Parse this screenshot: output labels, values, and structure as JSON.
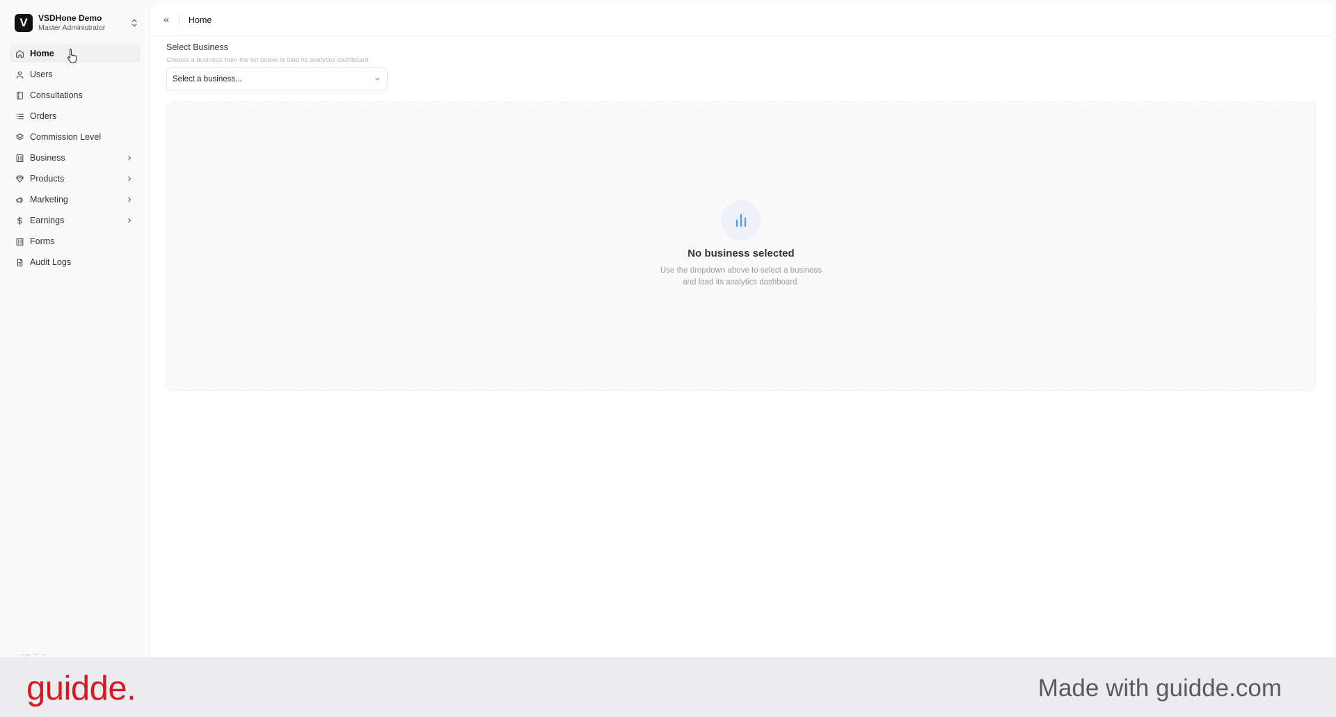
{
  "org": {
    "initial": "V",
    "name": "VSDHone Demo",
    "role": "Master Administrator"
  },
  "sidebar": {
    "items": [
      {
        "label": "Home",
        "icon": "home-icon",
        "active": true,
        "has_children": false
      },
      {
        "label": "Users",
        "icon": "user-icon",
        "active": false,
        "has_children": false
      },
      {
        "label": "Consultations",
        "icon": "book-icon",
        "active": false,
        "has_children": false
      },
      {
        "label": "Orders",
        "icon": "list-icon",
        "active": false,
        "has_children": false
      },
      {
        "label": "Commission Level",
        "icon": "layers-icon",
        "active": false,
        "has_children": false
      },
      {
        "label": "Business",
        "icon": "building-icon",
        "active": false,
        "has_children": true
      },
      {
        "label": "Products",
        "icon": "gem-icon",
        "active": false,
        "has_children": true
      },
      {
        "label": "Marketing",
        "icon": "megaphone-icon",
        "active": false,
        "has_children": true
      },
      {
        "label": "Earnings",
        "icon": "dollar-icon",
        "active": false,
        "has_children": true
      },
      {
        "label": "Forms",
        "icon": "building-icon",
        "active": false,
        "has_children": false
      },
      {
        "label": "Audit Logs",
        "icon": "file-icon",
        "active": false,
        "has_children": false
      }
    ]
  },
  "header": {
    "breadcrumb": "Home"
  },
  "main": {
    "select_title": "Select Business",
    "select_description": "Choose a business from the list below to load its analytics dashboard",
    "select_placeholder": "Select a business...",
    "empty_title": "No business selected",
    "empty_desc_line1": "Use the dropdown above to select a business",
    "empty_desc_line2": "and load its analytics dashboard."
  },
  "footer": {
    "brand": "guidde.",
    "tagline": "Made with guidde.com"
  },
  "colors": {
    "brand_red": "#d71920",
    "chart_icon_blue": "#5b9be0",
    "footer_bg": "#ebecef"
  }
}
